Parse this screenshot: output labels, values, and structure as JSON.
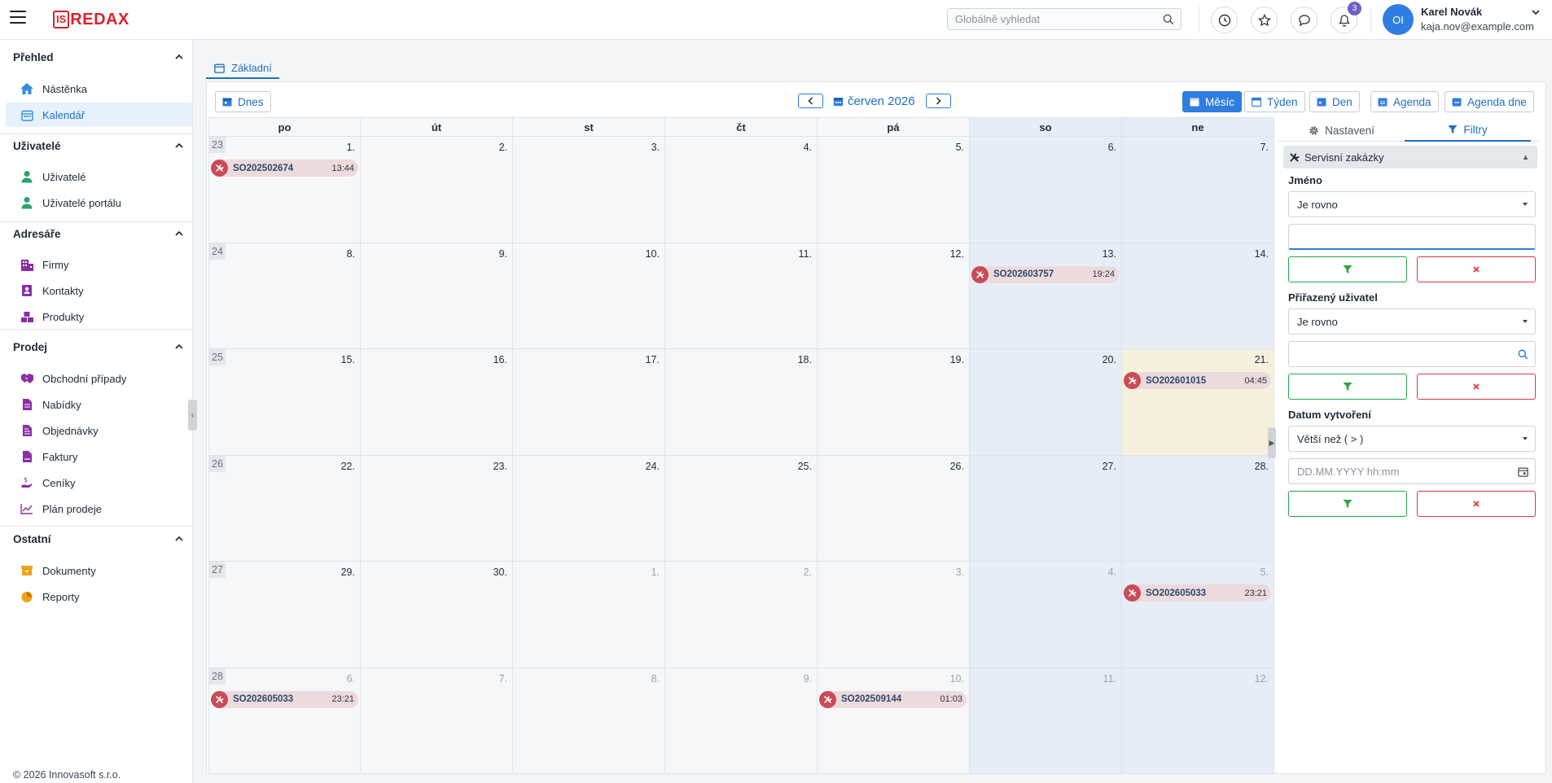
{
  "app": {
    "logo_box": "IS",
    "logo_text": "REDAX"
  },
  "search": {
    "placeholder": "Globálně vyhledat"
  },
  "notifications": {
    "count": "3"
  },
  "user": {
    "initials": "OI",
    "name": "Karel Novák",
    "email": "kaja.nov@example.com"
  },
  "sidebar": {
    "sections": {
      "prehled": "Přehled",
      "uzivatele": "Uživatelé",
      "adresare": "Adresáře",
      "prodej": "Prodej",
      "ostatni": "Ostatní"
    },
    "items": {
      "nastenka": "Nástěnka",
      "kalendar": "Kalendář",
      "uzivatele": "Uživatelé",
      "uzivatele_portalu": "Uživatelé portálu",
      "firmy": "Firmy",
      "kontakty": "Kontakty",
      "produkty": "Produkty",
      "obchodni_pripady": "Obchodní případy",
      "nabidky": "Nabídky",
      "objednavky": "Objednávky",
      "faktury": "Faktury",
      "ceniky": "Ceníky",
      "plan_prodeje": "Plán prodeje",
      "dokumenty": "Dokumenty",
      "reporty": "Reporty"
    },
    "footer": "© 2026 Innovasoft s.r.o."
  },
  "tabs": {
    "zakladni": "Základní"
  },
  "toolbar": {
    "today": "Dnes",
    "month_title": "červen 2026",
    "views": {
      "month": "Měsíc",
      "week": "Týden",
      "day": "Den",
      "agenda": "Agenda",
      "agenda_day": "Agenda dne"
    }
  },
  "calendar": {
    "weekdays": [
      "po",
      "út",
      "st",
      "čt",
      "pá",
      "so",
      "ne"
    ],
    "weeks": [
      {
        "no": "23",
        "days": [
          {
            "n": "1.",
            "event": {
              "code": "SO202502674",
              "time": "13:44"
            }
          },
          {
            "n": "2."
          },
          {
            "n": "3."
          },
          {
            "n": "4."
          },
          {
            "n": "5."
          },
          {
            "n": "6."
          },
          {
            "n": "7."
          }
        ]
      },
      {
        "no": "24",
        "days": [
          {
            "n": "8."
          },
          {
            "n": "9."
          },
          {
            "n": "10."
          },
          {
            "n": "11."
          },
          {
            "n": "12."
          },
          {
            "n": "13.",
            "event": {
              "code": "SO202603757",
              "time": "19:24"
            }
          },
          {
            "n": "14."
          }
        ]
      },
      {
        "no": "25",
        "days": [
          {
            "n": "15."
          },
          {
            "n": "16."
          },
          {
            "n": "17."
          },
          {
            "n": "18."
          },
          {
            "n": "19."
          },
          {
            "n": "20."
          },
          {
            "n": "21.",
            "today": true,
            "event": {
              "code": "SO202601015",
              "time": "04:45"
            }
          }
        ]
      },
      {
        "no": "26",
        "days": [
          {
            "n": "22."
          },
          {
            "n": "23."
          },
          {
            "n": "24."
          },
          {
            "n": "25."
          },
          {
            "n": "26."
          },
          {
            "n": "27."
          },
          {
            "n": "28."
          }
        ]
      },
      {
        "no": "27",
        "days": [
          {
            "n": "29."
          },
          {
            "n": "30."
          },
          {
            "n": "1.",
            "other": true
          },
          {
            "n": "2.",
            "other": true
          },
          {
            "n": "3.",
            "other": true
          },
          {
            "n": "4.",
            "other": true
          },
          {
            "n": "5.",
            "other": true,
            "event": {
              "code": "SO202605033",
              "time": "23:21"
            }
          }
        ]
      },
      {
        "no": "28",
        "days": [
          {
            "n": "6.",
            "other": true,
            "event": {
              "code": "SO202605033",
              "time": "23:21"
            }
          },
          {
            "n": "7.",
            "other": true
          },
          {
            "n": "8.",
            "other": true
          },
          {
            "n": "9.",
            "other": true
          },
          {
            "n": "10.",
            "other": true,
            "event": {
              "code": "SO202509144",
              "time": "01:03"
            }
          },
          {
            "n": "11.",
            "other": true
          },
          {
            "n": "12.",
            "other": true
          }
        ]
      }
    ]
  },
  "filters": {
    "tab_settings": "Nastavení",
    "tab_filters": "Filtry",
    "section": "Servisní zakázky",
    "name_label": "Jméno",
    "name_operator": "Je rovno",
    "name_value": "",
    "assigned_label": "Přiřazený uživatel",
    "assigned_operator": "Je rovno",
    "assigned_value": "",
    "created_label": "Datum vytvoření",
    "created_operator": "Větší než ( > )",
    "created_placeholder": "DD.MM.YYYY hh:mm"
  },
  "colors": {
    "accent": "#2f7de1",
    "brand": "#d8232a",
    "event_icon": "#c94c55",
    "event_bg": "#eddadd",
    "weekend_bg": "#e6edf7",
    "today_bg": "#f6f1dc"
  },
  "icons": {
    "menu": "hamburger-icon",
    "search": "search-icon",
    "history": "clock-icon",
    "favorites": "star-icon",
    "chat": "chat-icon",
    "notifications": "bell-icon",
    "event": "wrench-screwdriver-icon",
    "filter": "funnel-icon",
    "clear": "x-icon",
    "date": "calendar-icon"
  }
}
